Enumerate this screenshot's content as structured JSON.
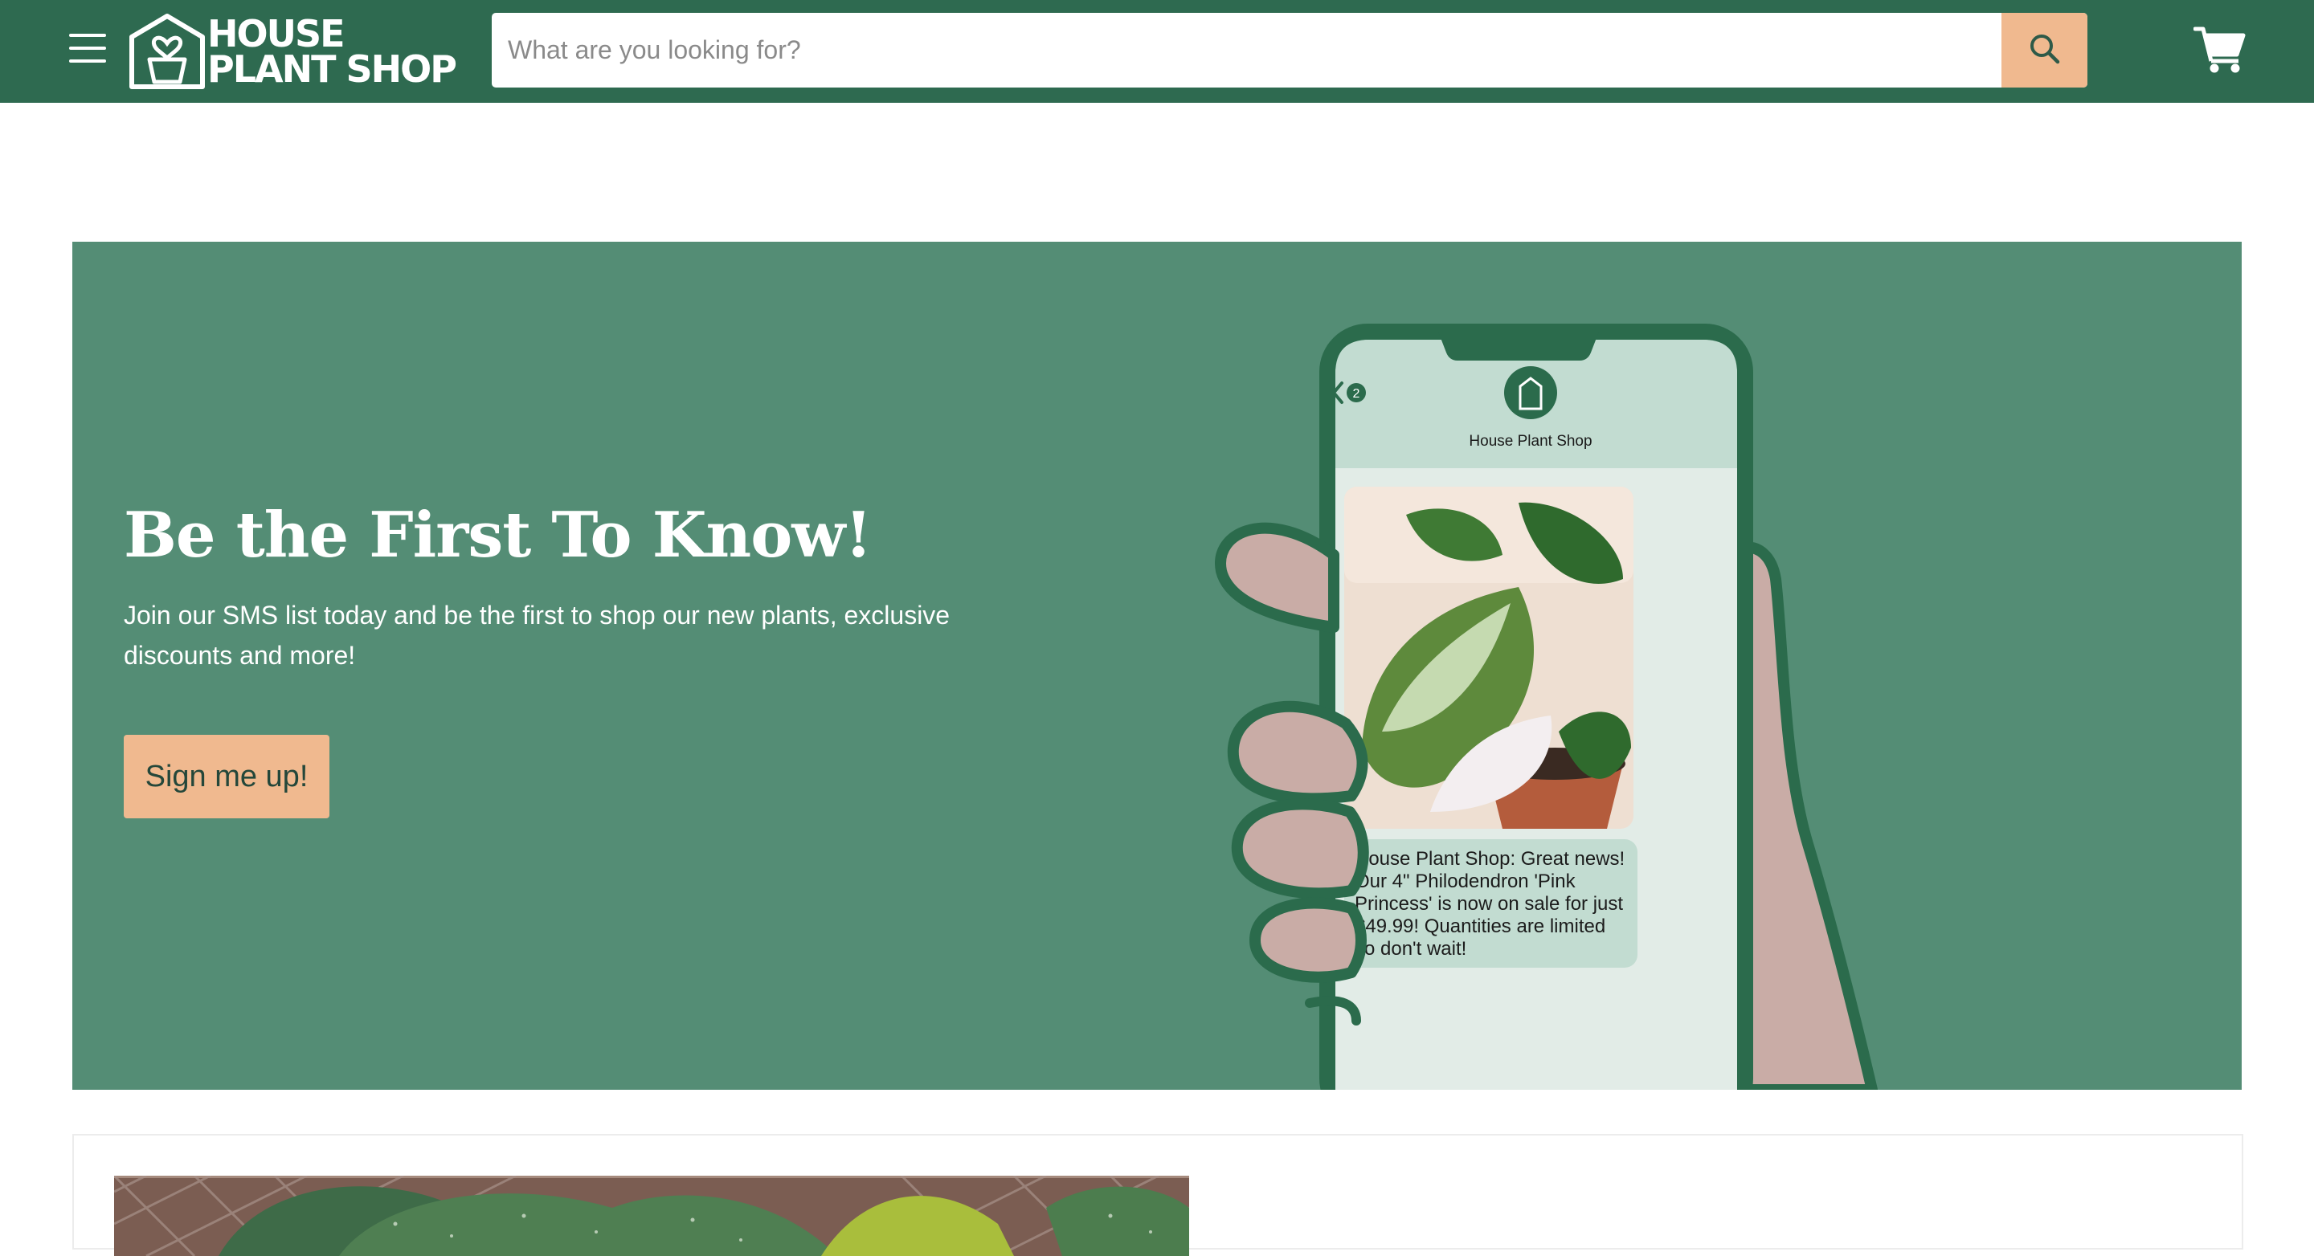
{
  "header": {
    "logo_line1": "HOUSE",
    "logo_line2": "PLANT SHOP",
    "search_placeholder": "What are you looking for?",
    "brand_color": "#2e6a50",
    "accent_color": "#f0b98f",
    "icons": [
      "menu-icon",
      "search-icon",
      "cart-icon"
    ]
  },
  "banner": {
    "title": "Be the First To Know!",
    "description": "Join our SMS list today and be the first to shop our new plants, exclusive discounts and more!",
    "button_label": "Sign me up!",
    "background_color": "#548d75"
  },
  "phone": {
    "back_count": "2",
    "contact_name": "House Plant Shop",
    "message_lines": [
      "House Plant Shop: Great news!",
      "Our 4\" Philodendron 'Pink",
      "Princess' is now on sale for just",
      "$49.99! Quantities are limited",
      "so don't wait!"
    ]
  }
}
